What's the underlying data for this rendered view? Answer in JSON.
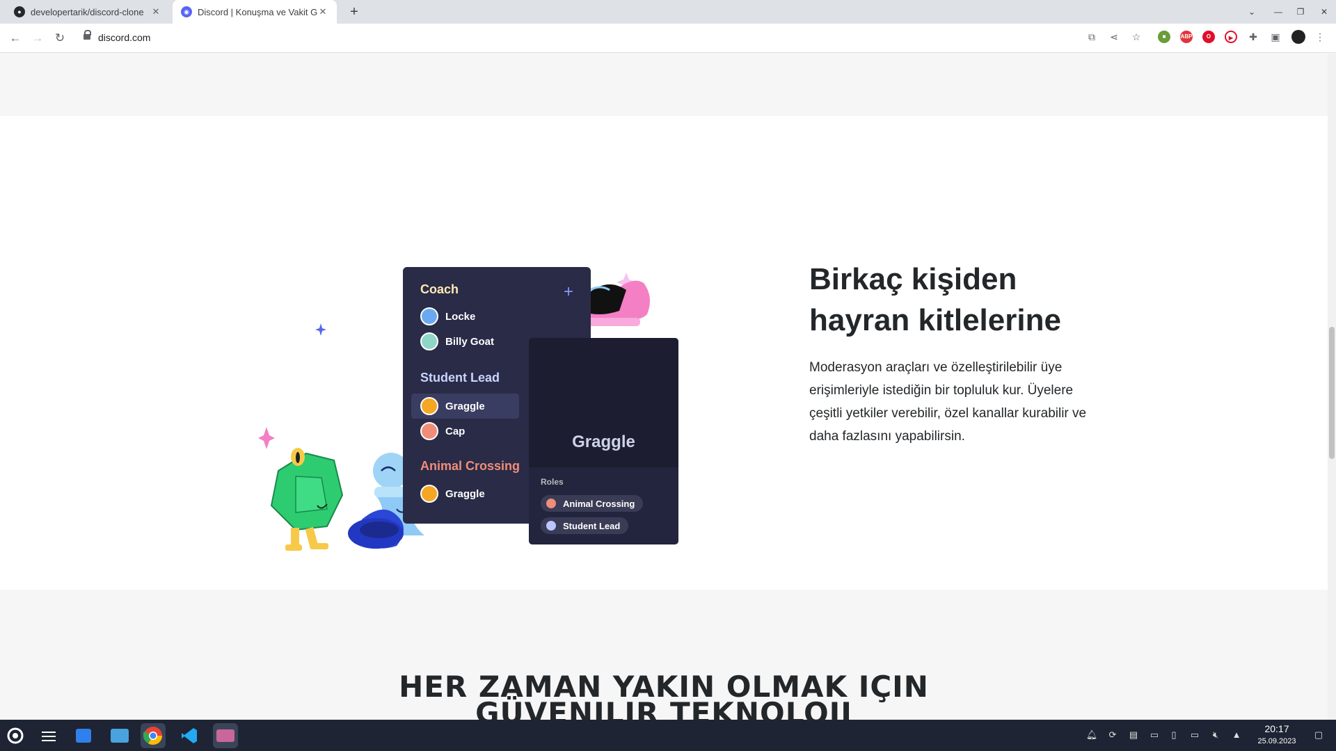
{
  "browser": {
    "tabs": [
      {
        "title": "developertarik/discord-clone",
        "active": false
      },
      {
        "title": "Discord | Konuşma ve Vakit Geçirme Yeri",
        "active": true
      }
    ],
    "url": "discord.com"
  },
  "hero": {
    "headline": "Birkaç kişiden hayran kitlelerine",
    "description": "Moderasyon araçları ve özelleştirilebilir üye erişimleriyle istediğin bir topluluk kur. Üyelere çeşitli yetkiler verebilir, özel kanallar kurabilir ve daha fazlasını yapabilirsin."
  },
  "illustration": {
    "groups": [
      {
        "name": "Coach",
        "color": "#ffe9b5",
        "members": [
          "Locke",
          "Billy Goat"
        ]
      },
      {
        "name": "Student Lead",
        "color": "#c9d4ff",
        "members": [
          "Graggle",
          "Cap"
        ]
      },
      {
        "name": "Animal Crossing",
        "color": "#f08d79",
        "members": [
          "Graggle"
        ]
      }
    ],
    "profile": {
      "name": "Graggle",
      "roles_label": "Roles",
      "roles": [
        {
          "name": "Animal Crossing",
          "color": "#f08d79"
        },
        {
          "name": "Student Lead",
          "color": "#b9c6ff"
        }
      ]
    }
  },
  "section2": {
    "heading_line1": "HER ZAMAN YAKIN OLMAK IÇIN",
    "heading_line2": "GÜVENILIR TEKNOLOJI"
  },
  "taskbar": {
    "time": "20:17",
    "date": "25.09.2023"
  }
}
